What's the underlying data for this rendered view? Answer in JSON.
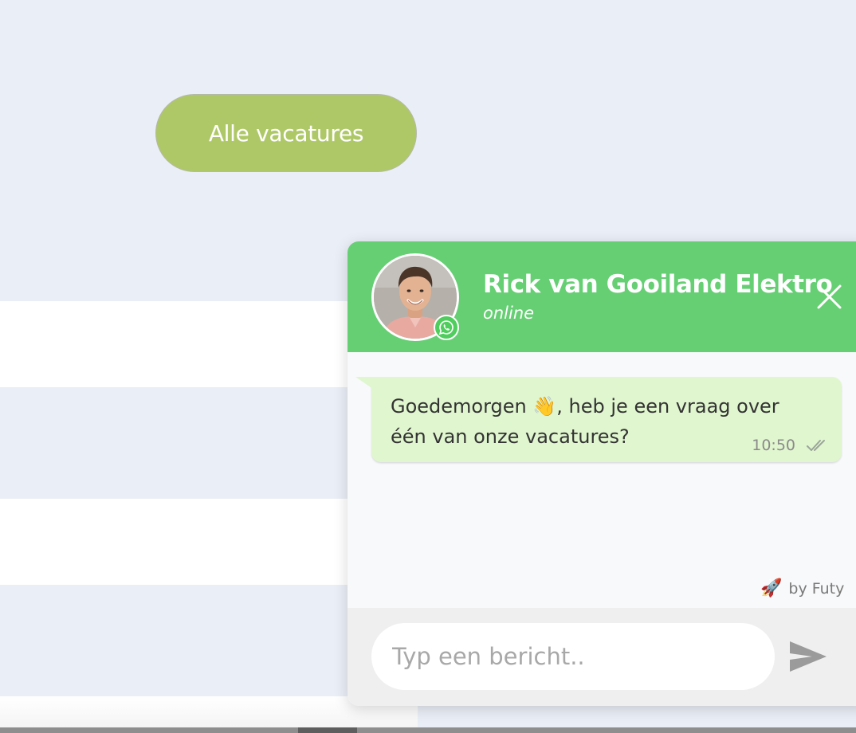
{
  "page": {
    "all_jobs_button": "Alle vacatures"
  },
  "chat": {
    "contact_name": "Rick van Gooiland Elektro",
    "status": "online",
    "avatar_icon": "person-photo",
    "messenger_badge_icon": "whatsapp-icon",
    "close_icon": "close-icon",
    "message": {
      "text": "Goedemorgen 👋, heb je een vraag over één van onze vacatures?",
      "time": "10:50",
      "status_icon": "double-check-icon"
    },
    "powered_by": {
      "icon": "🚀",
      "text": "by Futy"
    },
    "input": {
      "placeholder": "Typ een bericht.."
    },
    "send_icon": "send-icon"
  },
  "colors": {
    "page_background": "#eaeef6",
    "button_green": "#afc867",
    "header_green": "#66cf74",
    "bubble_green": "#e0f6cf",
    "input_bar": "#efefef"
  }
}
